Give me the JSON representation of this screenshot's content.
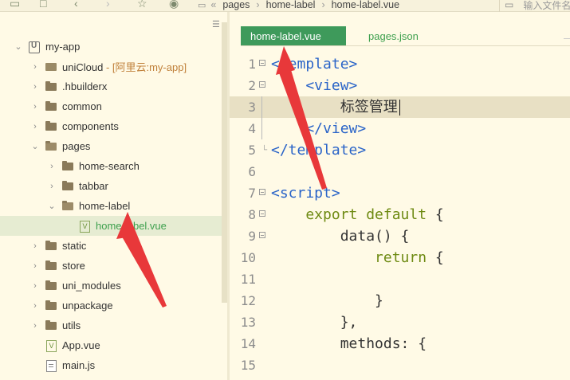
{
  "toolbar": {
    "path": [
      "pages",
      "home-label",
      "home-label.vue"
    ],
    "search_placeholder": "输入文件名"
  },
  "sidebar": {
    "items": [
      {
        "label": "my-app",
        "type": "project",
        "indent": 0,
        "expanded": true
      },
      {
        "label": "uniCloud",
        "sub": " - [阿里云:my-app]",
        "type": "cloud",
        "indent": 1
      },
      {
        "label": ".hbuilderx",
        "type": "folder",
        "indent": 1
      },
      {
        "label": "common",
        "type": "folder",
        "indent": 1
      },
      {
        "label": "components",
        "type": "folder",
        "indent": 1
      },
      {
        "label": "pages",
        "type": "folder",
        "indent": 1,
        "expanded": true
      },
      {
        "label": "home-search",
        "type": "folder",
        "indent": 2
      },
      {
        "label": "tabbar",
        "type": "folder",
        "indent": 2
      },
      {
        "label": "home-label",
        "type": "folder",
        "indent": 2,
        "expanded": true
      },
      {
        "label": "home-label.vue",
        "type": "vue",
        "indent": 3,
        "selected": true
      },
      {
        "label": "static",
        "type": "folder",
        "indent": 1
      },
      {
        "label": "store",
        "type": "folder",
        "indent": 1
      },
      {
        "label": "uni_modules",
        "type": "folder",
        "indent": 1
      },
      {
        "label": "unpackage",
        "type": "folder",
        "indent": 1
      },
      {
        "label": "utils",
        "type": "folder",
        "indent": 1
      },
      {
        "label": "App.vue",
        "type": "vuefile",
        "indent": 1
      },
      {
        "label": "main.js",
        "type": "js",
        "indent": 1
      }
    ]
  },
  "editor": {
    "tabs": [
      {
        "label": "home-label.vue",
        "active": true
      },
      {
        "label": "pages.json",
        "active": false
      }
    ],
    "lines": [
      {
        "num": "1",
        "fold": "open",
        "code": [
          {
            "t": "<template>",
            "c": "tag"
          }
        ]
      },
      {
        "num": "2",
        "fold": "open",
        "code": [
          {
            "t": "    <view>",
            "c": "tag"
          }
        ]
      },
      {
        "num": "3",
        "fold": "line",
        "code": [
          {
            "t": "        标签管理",
            "c": "fn"
          }
        ],
        "cursor": true,
        "highlight": true
      },
      {
        "num": "4",
        "fold": "line",
        "code": [
          {
            "t": "    </view>",
            "c": "tag"
          }
        ]
      },
      {
        "num": "5",
        "fold": "end",
        "code": [
          {
            "t": "</template>",
            "c": "tag"
          }
        ]
      },
      {
        "num": "6",
        "fold": "",
        "code": []
      },
      {
        "num": "7",
        "fold": "open",
        "code": [
          {
            "t": "<script>",
            "c": "tag"
          }
        ]
      },
      {
        "num": "8",
        "fold": "open",
        "code": [
          {
            "t": "    export default ",
            "c": "kw"
          },
          {
            "t": "{",
            "c": "fn"
          }
        ]
      },
      {
        "num": "9",
        "fold": "open",
        "code": [
          {
            "t": "        data",
            "c": "fn"
          },
          {
            "t": "() {",
            "c": "fn"
          }
        ]
      },
      {
        "num": "10",
        "fold": "",
        "code": [
          {
            "t": "            return",
            "c": "kw"
          },
          {
            "t": " {",
            "c": "fn"
          }
        ]
      },
      {
        "num": "11",
        "fold": "",
        "code": []
      },
      {
        "num": "12",
        "fold": "",
        "code": [
          {
            "t": "            }",
            "c": "fn"
          }
        ]
      },
      {
        "num": "13",
        "fold": "",
        "code": [
          {
            "t": "        },",
            "c": "fn"
          }
        ]
      },
      {
        "num": "14",
        "fold": "",
        "code": [
          {
            "t": "        methods: {",
            "c": "fn"
          }
        ]
      },
      {
        "num": "15",
        "fold": "",
        "code": []
      }
    ]
  },
  "colors": {
    "accent": "#3e9a5b",
    "arrow": "#e8383a",
    "tag": "#2a64c8",
    "keyword": "#6e8a12"
  }
}
